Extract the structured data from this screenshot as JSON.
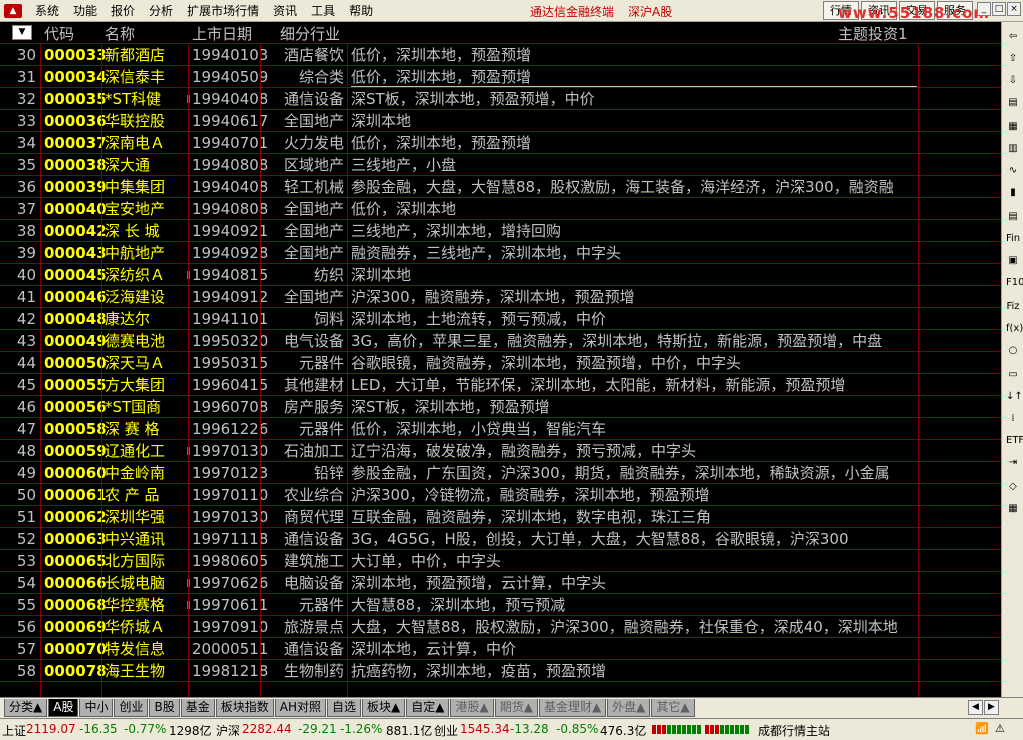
{
  "menu": {
    "items": [
      "系统",
      "功能",
      "报价",
      "分析",
      "扩展市场行情",
      "资讯",
      "工具",
      "帮助"
    ],
    "app_title": "通达信金融终端",
    "market": "深沪A股",
    "right_buttons": [
      "行情",
      "资讯",
      "交易",
      "服务"
    ],
    "watermark": "www.55188.com",
    "window_controls": [
      "_",
      "□",
      "×"
    ]
  },
  "grid": {
    "sort_button": "▼",
    "columns": [
      "代码",
      "名称",
      "上市日期",
      "细分行业"
    ],
    "theme_label": "主题投资1",
    "rows": [
      {
        "idx": "30",
        "code": "000033",
        "name": "新都酒店",
        "date": "19940103",
        "industry": "酒店餐饮",
        "concept": "低价，深圳本地，预盈预增",
        "flag": false
      },
      {
        "idx": "31",
        "code": "000034",
        "name": "深信泰丰",
        "date": "19940509",
        "industry": "综合类",
        "concept": "低价，深圳本地，预盈预增",
        "flag": false
      },
      {
        "idx": "32",
        "code": "000035",
        "name": "*ST科健",
        "date": "19940408",
        "industry": "通信设备",
        "concept": "深ST板，深圳本地，预盈预增，中价",
        "flag": true
      },
      {
        "idx": "33",
        "code": "000036",
        "name": "华联控股",
        "date": "19940617",
        "industry": "全国地产",
        "concept": "深圳本地",
        "flag": false
      },
      {
        "idx": "34",
        "code": "000037",
        "name": "深南电Ａ",
        "date": "19940701",
        "industry": "火力发电",
        "concept": "低价，深圳本地，预盈预增",
        "flag": false
      },
      {
        "idx": "35",
        "code": "000038",
        "name": "深大通",
        "date": "19940808",
        "industry": "区域地产",
        "concept": "三线地产，小盘",
        "flag": false
      },
      {
        "idx": "36",
        "code": "000039",
        "name": "中集集团",
        "date": "19940408",
        "industry": "轻工机械",
        "concept": "参股金融，大盘，大智慧88，股权激励，海工装备，海洋经济，沪深300，融资融",
        "flag": false
      },
      {
        "idx": "37",
        "code": "000040",
        "name": "宝安地产",
        "date": "19940808",
        "industry": "全国地产",
        "concept": "低价，深圳本地",
        "flag": false
      },
      {
        "idx": "38",
        "code": "000042",
        "name": "深 长 城",
        "date": "19940921",
        "industry": "全国地产",
        "concept": "三线地产，深圳本地，增持回购",
        "flag": false
      },
      {
        "idx": "39",
        "code": "000043",
        "name": "中航地产",
        "date": "19940928",
        "industry": "全国地产",
        "concept": "融资融券，三线地产，深圳本地，中字头",
        "flag": false
      },
      {
        "idx": "40",
        "code": "000045",
        "name": "深纺织Ａ",
        "date": "19940815",
        "industry": "纺织",
        "concept": "深圳本地",
        "flag": true
      },
      {
        "idx": "41",
        "code": "000046",
        "name": "泛海建设",
        "date": "19940912",
        "industry": "全国地产",
        "concept": "沪深300，融资融券，深圳本地，预盈预增",
        "flag": false
      },
      {
        "idx": "42",
        "code": "000048",
        "name": "康达尔",
        "date": "19941101",
        "industry": "饲料",
        "concept": "深圳本地，土地流转，预亏预减，中价",
        "flag": false
      },
      {
        "idx": "43",
        "code": "000049",
        "name": "德赛电池",
        "date": "19950320",
        "industry": "电气设备",
        "concept": "3G，高价，苹果三星，融资融券，深圳本地，特斯拉，新能源，预盈预增，中盘",
        "flag": false
      },
      {
        "idx": "44",
        "code": "000050",
        "name": "深天马Ａ",
        "date": "19950315",
        "industry": "元器件",
        "concept": "谷歌眼镜，融资融券，深圳本地，预盈预增，中价，中字头",
        "flag": false
      },
      {
        "idx": "45",
        "code": "000055",
        "name": "方大集团",
        "date": "19960415",
        "industry": "其他建材",
        "concept": "LED，大订单，节能环保，深圳本地，太阳能，新材料，新能源，预盈预增",
        "flag": false
      },
      {
        "idx": "46",
        "code": "000056",
        "name": "*ST国商",
        "date": "19960708",
        "industry": "房产服务",
        "concept": "深ST板，深圳本地，预盈预增",
        "flag": false
      },
      {
        "idx": "47",
        "code": "000058",
        "name": "深 赛 格",
        "date": "19961226",
        "industry": "元器件",
        "concept": "低价，深圳本地，小贷典当，智能汽车",
        "flag": false
      },
      {
        "idx": "48",
        "code": "000059",
        "name": "辽通化工",
        "date": "19970130",
        "industry": "石油加工",
        "concept": "辽宁沿海，破发破净，融资融券，预亏预减，中字头",
        "flag": true
      },
      {
        "idx": "49",
        "code": "000060",
        "name": "中金岭南",
        "date": "19970123",
        "industry": "铅锌",
        "concept": "参股金融，广东国资，沪深300，期货，融资融券，深圳本地，稀缺资源，小金属",
        "flag": false
      },
      {
        "idx": "50",
        "code": "000061",
        "name": "农 产 品",
        "date": "19970110",
        "industry": "农业综合",
        "concept": "沪深300，冷链物流，融资融券，深圳本地，预盈预增",
        "flag": false
      },
      {
        "idx": "51",
        "code": "000062",
        "name": "深圳华强",
        "date": "19970130",
        "industry": "商贸代理",
        "concept": "互联金融，融资融券，深圳本地，数字电视，珠江三角",
        "flag": false
      },
      {
        "idx": "52",
        "code": "000063",
        "name": "中兴通讯",
        "date": "19971118",
        "industry": "通信设备",
        "concept": "3G，4G5G，H股，创投，大订单，大盘，大智慧88，谷歌眼镜，沪深300",
        "flag": false
      },
      {
        "idx": "53",
        "code": "000065",
        "name": "北方国际",
        "date": "19980605",
        "industry": "建筑施工",
        "concept": "大订单，中价，中字头",
        "flag": false
      },
      {
        "idx": "54",
        "code": "000066",
        "name": "长城电脑",
        "date": "19970626",
        "industry": "电脑设备",
        "concept": "深圳本地，预盈预增，云计算，中字头",
        "flag": true
      },
      {
        "idx": "55",
        "code": "000068",
        "name": "华控赛格",
        "date": "19970611",
        "industry": "元器件",
        "concept": "大智慧88，深圳本地，预亏预减",
        "flag": true
      },
      {
        "idx": "56",
        "code": "000069",
        "name": "华侨城Ａ",
        "date": "19970910",
        "industry": "旅游景点",
        "concept": "大盘，大智慧88，股权激励，沪深300，融资融券，社保重仓，深成40，深圳本地",
        "flag": false
      },
      {
        "idx": "57",
        "code": "000070",
        "name": "特发信息",
        "date": "20000511",
        "industry": "通信设备",
        "concept": "深圳本地，云计算，中价",
        "flag": false
      },
      {
        "idx": "58",
        "code": "000078",
        "name": "海王生物",
        "date": "19981218",
        "industry": "生物制药",
        "concept": "抗癌药物，深圳本地，疫苗，预盈预增",
        "flag": false
      }
    ]
  },
  "toolbar_right": [
    "⇦",
    "⇧",
    "⇩",
    "▤",
    "▦",
    "▥",
    "∿",
    "▮",
    "▤",
    "Fin",
    "▣",
    "F10",
    "Fiz",
    "f(x)",
    "○",
    "▭",
    "↓↑",
    "⁞",
    "ETF",
    "⇥",
    "◇",
    "▦"
  ],
  "tabs": [
    {
      "label": "分类▲",
      "active": false,
      "dim": false
    },
    {
      "label": "A股",
      "active": true,
      "dim": false
    },
    {
      "label": "中小",
      "active": false,
      "dim": false
    },
    {
      "label": "创业",
      "active": false,
      "dim": false
    },
    {
      "label": "B股",
      "active": false,
      "dim": false
    },
    {
      "label": "基金",
      "active": false,
      "dim": false
    },
    {
      "label": "板块指数",
      "active": false,
      "dim": false
    },
    {
      "label": "AH对照",
      "active": false,
      "dim": false
    },
    {
      "label": "自选",
      "active": false,
      "dim": false
    },
    {
      "label": "板块▲",
      "active": false,
      "dim": false
    },
    {
      "label": "自定▲",
      "active": false,
      "dim": false
    },
    {
      "label": "港股▲",
      "active": false,
      "dim": true
    },
    {
      "label": "期货▲",
      "active": false,
      "dim": true
    },
    {
      "label": "基金理财▲",
      "active": false,
      "dim": true
    },
    {
      "label": "外盘▲",
      "active": false,
      "dim": true
    },
    {
      "label": "其它▲",
      "active": false,
      "dim": true
    }
  ],
  "status": {
    "sh_label": "上证",
    "sh_index": "2119.07",
    "sh_change": "-16.35",
    "sh_pct": "-0.77%",
    "sh_vol": "1298亿",
    "hs_label": "沪深",
    "hs_index": "2282.44",
    "hs_change": "-29.21",
    "hs_pct": "-1.26%",
    "hs_vol": "881.1亿",
    "cy_label": "创业",
    "cy_index": "1545.34",
    "cy_change": "-13.28",
    "cy_pct": "-0.85%",
    "cy_vol": "476.3亿",
    "site": "成都行情主站",
    "colors": {
      "up": "#c00000",
      "down": "#008000",
      "accent": "#ffff00",
      "grid_line": "#800000"
    }
  }
}
